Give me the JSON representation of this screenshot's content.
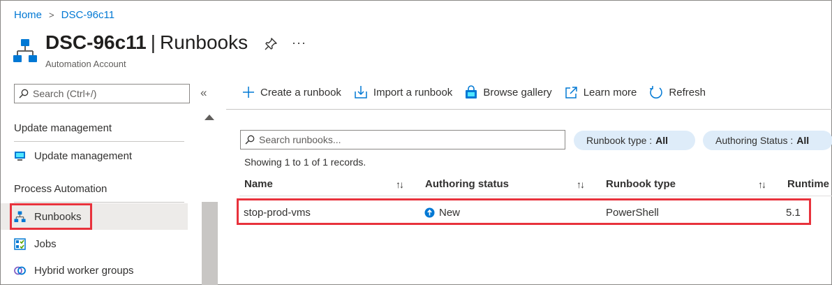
{
  "breadcrumb": {
    "home": "Home",
    "separator": ">",
    "resource": "DSC-96c11"
  },
  "header": {
    "resource_name": "DSC-96c11",
    "separator": "|",
    "blade_title": "Runbooks",
    "subtitle": "Automation Account",
    "more": "···",
    "icons": {
      "resource": "runbook-hierarchy-icon",
      "pin": "pin-icon",
      "more": "ellipsis-icon"
    }
  },
  "nav": {
    "search_placeholder": "Search (Ctrl+/)",
    "collapse": "«",
    "sections": [
      {
        "title": "Update management",
        "items": [
          {
            "label": "Update management",
            "icon": "monitor-icon"
          }
        ]
      },
      {
        "title": "Process Automation",
        "items": [
          {
            "label": "Runbooks",
            "icon": "runbook-hierarchy-icon",
            "selected": true
          },
          {
            "label": "Jobs",
            "icon": "jobs-grid-icon"
          },
          {
            "label": "Hybrid worker groups",
            "icon": "hybrid-worker-icon"
          }
        ]
      }
    ]
  },
  "toolbar": {
    "create": "Create a runbook",
    "import": "Import a runbook",
    "gallery": "Browse gallery",
    "learn": "Learn more",
    "refresh": "Refresh"
  },
  "filters": {
    "search_placeholder": "Search runbooks...",
    "type_label": "Runbook type :",
    "type_value": "All",
    "status_label": "Authoring Status :",
    "status_value": "All"
  },
  "records_text": "Showing 1 to 1 of 1 records.",
  "table": {
    "columns": [
      "Name",
      "Authoring status",
      "Runbook type",
      "Runtime"
    ],
    "sort_glyph": "↑↓",
    "rows": [
      {
        "name": "stop-prod-vms",
        "status": "New",
        "type": "PowerShell",
        "runtime": "5.1"
      }
    ]
  },
  "colors": {
    "accent": "#0078d4",
    "highlight": "#e8323c",
    "pill": "#deecf9",
    "selected": "#edebe9"
  }
}
